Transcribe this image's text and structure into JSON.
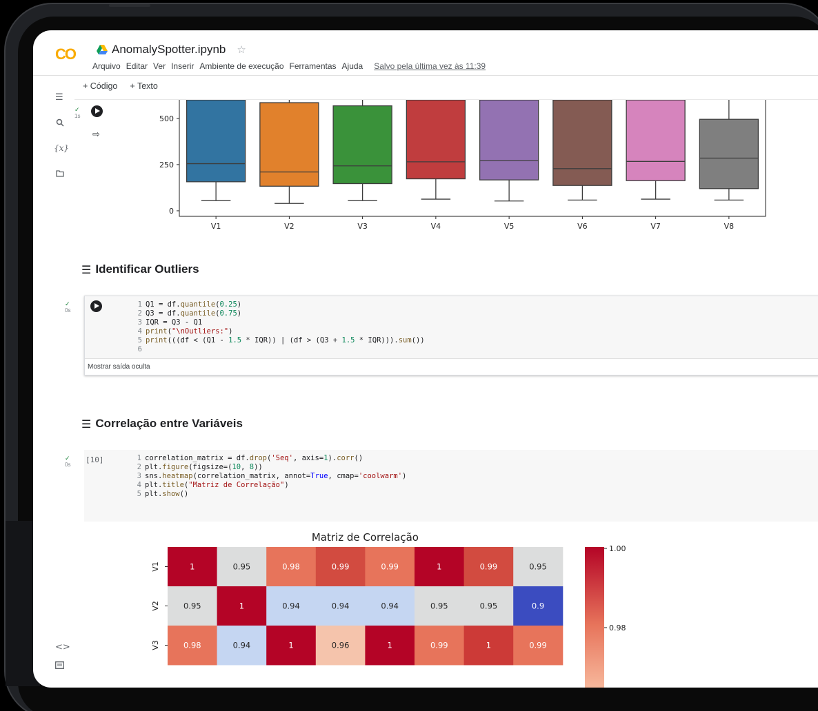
{
  "header": {
    "logo": "CO",
    "notebook_title": "AnomalySpotter.ipynb",
    "star_icon": "star-outline-icon",
    "menu": [
      "Arquivo",
      "Editar",
      "Ver",
      "Inserir",
      "Ambiente de execução",
      "Ferramentas",
      "Ajuda"
    ],
    "saved_status": "Salvo pela última vez às 11:39"
  },
  "toolbar": {
    "add_code": "+ Código",
    "add_text": "+ Texto"
  },
  "rail": {
    "icons": [
      "toc-icon",
      "search-icon",
      "variables-icon",
      "folder-icon",
      "code-snippets-icon",
      "terminal-icon"
    ],
    "variables_label": "{x}",
    "code_label": "<>"
  },
  "cell1": {
    "status_check": "✓",
    "status_time": "1s"
  },
  "boxplot": {
    "chart_data": {
      "type": "box",
      "categories": [
        "V1",
        "V2",
        "V3",
        "V4",
        "V5",
        "V6",
        "V7",
        "V8"
      ],
      "colors": [
        "#3274a1",
        "#e1812c",
        "#3a923a",
        "#c03d3e",
        "#9372b2",
        "#845b53",
        "#d684bd",
        "#7f7f7f"
      ],
      "ytick_labels": [
        "0",
        "250",
        "500"
      ],
      "series": [
        {
          "q1": 157,
          "median": 255,
          "q3": 600,
          "whisker_low": 55,
          "whisker_high": 600
        },
        {
          "q1": 133,
          "median": 210,
          "q3": 585,
          "whisker_low": 40,
          "whisker_high": 600
        },
        {
          "q1": 147,
          "median": 243,
          "q3": 568,
          "whisker_low": 55,
          "whisker_high": 600
        },
        {
          "q1": 173,
          "median": 265,
          "q3": 600,
          "whisker_low": 63,
          "whisker_high": 600
        },
        {
          "q1": 167,
          "median": 272,
          "q3": 600,
          "whisker_low": 53,
          "whisker_high": 600
        },
        {
          "q1": 137,
          "median": 228,
          "q3": 600,
          "whisker_low": 58,
          "whisker_high": 600
        },
        {
          "q1": 163,
          "median": 267,
          "q3": 600,
          "whisker_low": 63,
          "whisker_high": 600
        },
        {
          "q1": 120,
          "median": 285,
          "q3": 495,
          "whisker_low": 58,
          "whisker_high": 600
        }
      ]
    }
  },
  "section2": {
    "title": "Identificar Outliers",
    "status_check": "✓",
    "status_time": "0s",
    "code": [
      {
        "n": "1",
        "text": "Q1 = df.quantile(0.25)"
      },
      {
        "n": "2",
        "text": "Q3 = df.quantile(0.75)"
      },
      {
        "n": "3",
        "text": "IQR = Q3 - Q1"
      },
      {
        "n": "4",
        "text": "print(\"\\nOutliers:\")"
      },
      {
        "n": "5",
        "text": "print(((df < (Q1 - 1.5 * IQR)) | (df > (Q3 + 1.5 * IQR))).sum())"
      },
      {
        "n": "6",
        "text": ""
      }
    ],
    "footer": "Mostrar saída oculta"
  },
  "section3": {
    "title": "Correlação entre Variáveis",
    "status_check": "✓",
    "status_time": "0s",
    "exec_count": "[10]",
    "code": [
      {
        "n": "1",
        "text": "correlation_matrix = df.drop('Seq', axis=1).corr()"
      },
      {
        "n": "2",
        "text": "plt.figure(figsize=(10, 8))"
      },
      {
        "n": "3",
        "text": "sns.heatmap(correlation_matrix, annot=True, cmap='coolwarm')"
      },
      {
        "n": "4",
        "text": "plt.title(\"Matriz de Correlação\")"
      },
      {
        "n": "5",
        "text": "plt.show()"
      }
    ]
  },
  "heatmap": {
    "chart_data": {
      "type": "heatmap",
      "title": "Matriz de Correlação",
      "rows": [
        "V1",
        "V2",
        "V3"
      ],
      "values": [
        [
          "1",
          "0.95",
          "0.98",
          "0.99",
          "0.99",
          "1",
          "0.99",
          "0.95"
        ],
        [
          "0.95",
          "1",
          "0.94",
          "0.94",
          "0.94",
          "0.95",
          "0.95",
          "0.9"
        ],
        [
          "0.98",
          "0.94",
          "1",
          "0.96",
          "1",
          "0.99",
          "1",
          "0.99"
        ]
      ],
      "cell_colors": [
        [
          "#b40426",
          "#dcdddd",
          "#e7745b",
          "#d24b40",
          "#e7745b",
          "#b40426",
          "#d24b40",
          "#dcdddd"
        ],
        [
          "#dcdddd",
          "#b40426",
          "#c5d6f2",
          "#c5d6f2",
          "#c5d6f2",
          "#dcdddd",
          "#dcdddd",
          "#3b4cc0"
        ],
        [
          "#e7745b",
          "#c5d6f2",
          "#b40426",
          "#f5c4ac",
          "#b40426",
          "#e7745b",
          "#cc3a37",
          "#e7745b"
        ]
      ],
      "colorbar_ticks": [
        "1.00",
        "0.98"
      ]
    }
  }
}
